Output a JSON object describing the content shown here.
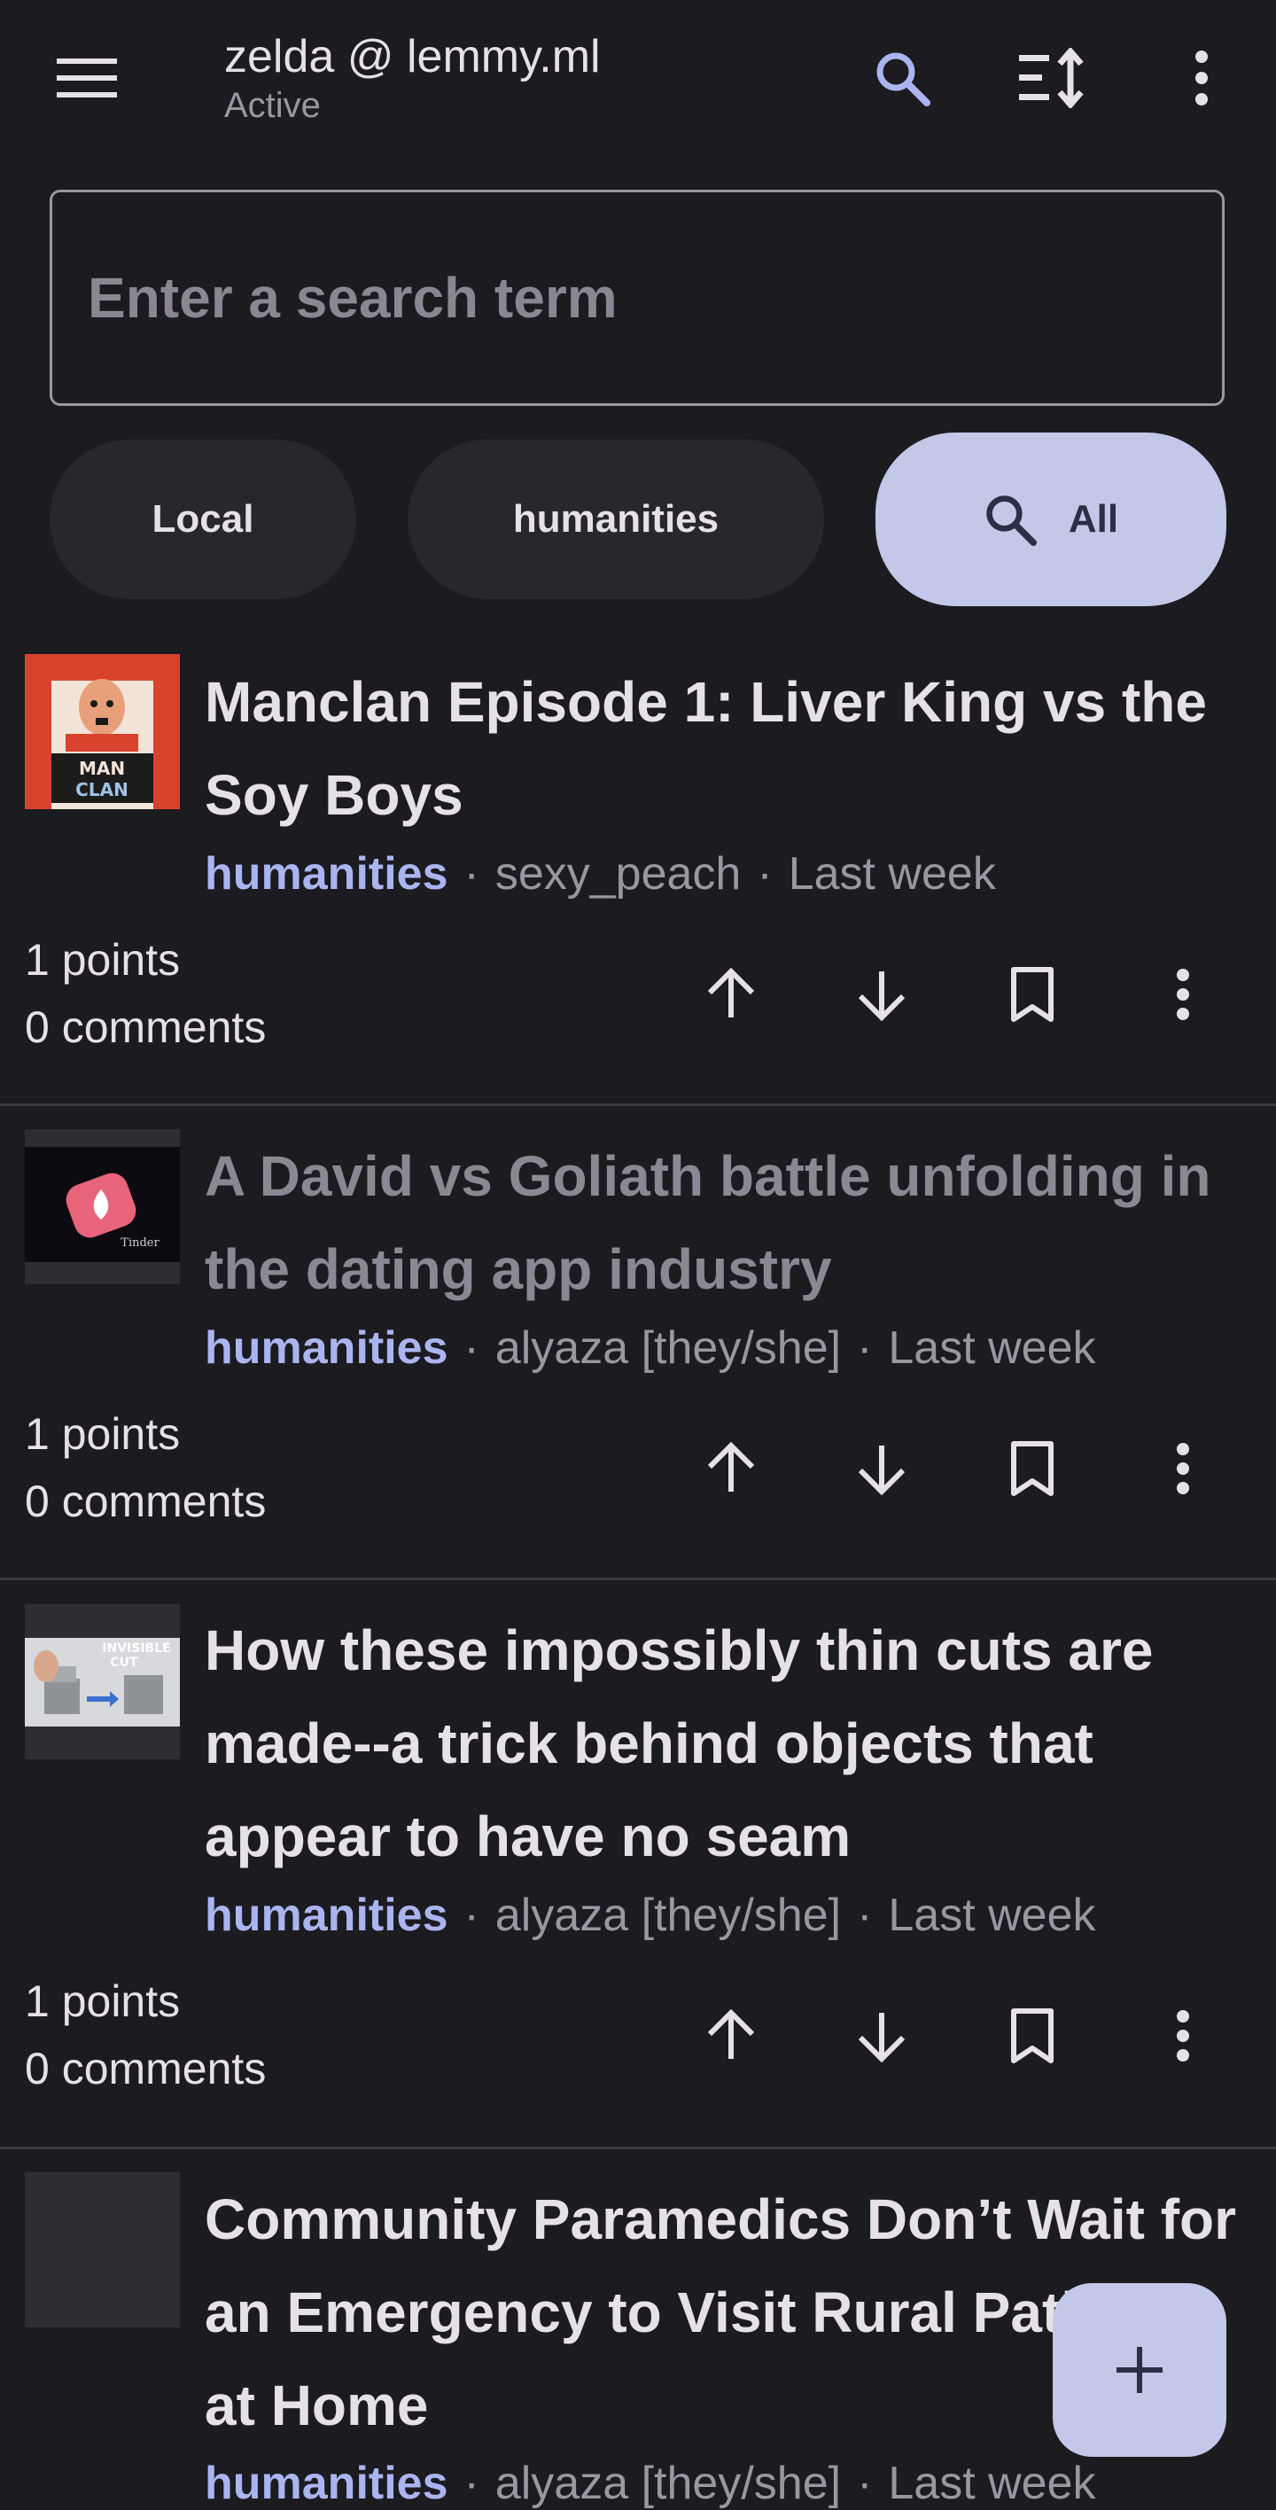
{
  "appbar": {
    "title": "zelda @ lemmy.ml",
    "subtitle": "Active",
    "icons": [
      "menu-icon",
      "search-icon",
      "sort-icon",
      "more-vert-icon"
    ]
  },
  "search": {
    "placeholder": "Enter a search term",
    "value": ""
  },
  "filters": {
    "chips": [
      {
        "label": "Local",
        "selected": false
      },
      {
        "label": "humanities",
        "selected": false
      },
      {
        "label": "All",
        "selected": true,
        "icon": "search-icon"
      }
    ]
  },
  "posts": [
    {
      "title": "Manclan Episode 1: Liver King vs the Soy Boys",
      "community": "humanities",
      "author": "sexy_peach",
      "time": "Last week",
      "points": "1 points",
      "comments": "0 comments",
      "read": false,
      "thumbnail_text": [
        "MAN",
        "CLAN"
      ]
    },
    {
      "title": "A David vs Goliath battle unfolding in the dating app industry",
      "community": "humanities",
      "author": "alyaza [they/she]",
      "time": "Last week",
      "points": "1 points",
      "comments": "0 comments",
      "read": true,
      "thumbnail_text": [
        "Tinder"
      ]
    },
    {
      "title": "How these impossibly thin cuts are made--a trick behind objects that appear to have no seam",
      "community": "humanities",
      "author": "alyaza [they/she]",
      "time": "Last week",
      "points": "1 points",
      "comments": "0 comments",
      "read": false,
      "thumbnail_text": [
        "INVISIBLE",
        "CUT"
      ]
    },
    {
      "title": "Community Paramedics Don’t Wait for an Emergency to Visit Rural Patients at Home",
      "community": "humanities",
      "author": "alyaza [they/she]",
      "time": "Last week",
      "read": false
    }
  ],
  "post_actions": [
    "arrow-up-icon",
    "arrow-down-icon",
    "bookmark-icon",
    "more-vert-icon"
  ],
  "fab": {
    "icon": "plus-icon"
  },
  "colors": {
    "background": "#1c1b20",
    "accent": "#c3c8e8",
    "community_link": "#aab5f0",
    "search_icon": "#aab5f0"
  }
}
